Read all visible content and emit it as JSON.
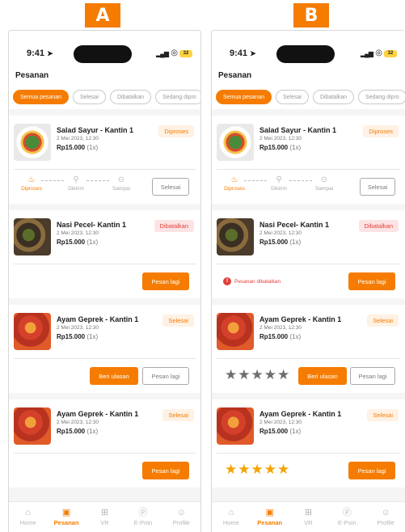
{
  "labels": {
    "a": "A",
    "b": "B"
  },
  "status": {
    "time": "9:41",
    "battery": "32"
  },
  "page_title": "Pesanan",
  "tabs": [
    "Semua pesanan",
    "Selesai",
    "Dibatalkan",
    "Sedang dipro"
  ],
  "orders": [
    {
      "name": "Salad Sayur - Kantin 1",
      "date": "2 Mei 2023, 12:30",
      "price": "Rp15.000",
      "qty": "(1x)",
      "status": "Diproses"
    },
    {
      "name": "Nasi Pecel- Kantin 1",
      "date": "2 Mei 2023, 12:30",
      "price": "Rp15.000",
      "qty": "(1x)",
      "status": "Dibatalkan"
    },
    {
      "name": "Ayam Geprek - Kantin 1",
      "date": "2 Mei 2023, 12:30",
      "price": "Rp15.000",
      "qty": "(1x)",
      "status": "Selesai"
    },
    {
      "name": "Ayam Geprek - Kantin 1",
      "date": "2 Mei 2023, 12:30",
      "price": "Rp15.000",
      "qty": "(1x)",
      "status": "Selesai"
    }
  ],
  "tracker": {
    "step1": "Diproses",
    "step2": "Dikirim",
    "step3": "Sampai"
  },
  "buttons": {
    "selesai": "Selesai",
    "pesan_lagi": "Pesan lagi",
    "beri_ulasan": "Beri ulasan"
  },
  "cancel_note": "Pesanan dibatalkan",
  "ratings": {
    "order3": 0,
    "order4": 5
  },
  "nav": [
    "Home",
    "Pesanan",
    "VR",
    "E-Poin",
    "Profile"
  ],
  "colors": {
    "accent": "#f57c00",
    "danger": "#e0403a",
    "star_gold": "#f5a300",
    "star_grey": "#6e6e6e"
  },
  "icons": [
    "navigation-arrow-icon",
    "signal-icon",
    "wifi-icon",
    "battery-icon",
    "cooking-pot-icon",
    "delivery-icon",
    "location-pin-icon",
    "warning-icon",
    "star-icon",
    "home-icon",
    "clipboard-icon",
    "vr-headset-icon",
    "points-icon",
    "user-icon"
  ]
}
